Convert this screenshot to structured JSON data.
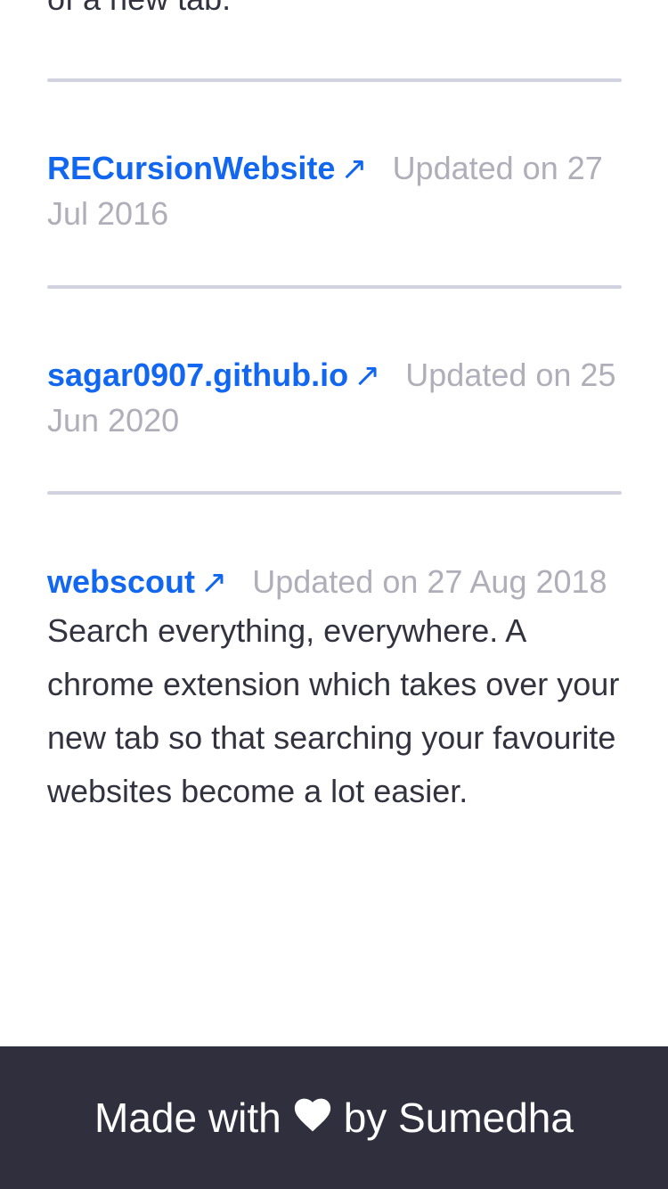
{
  "partial_text": "of a new tab.",
  "repos": [
    {
      "name": "RECursionWebsite",
      "arrow": "↗",
      "updated": "Updated on 27 Jul 2016",
      "description": ""
    },
    {
      "name": "sagar0907.github.io",
      "arrow": "↗",
      "updated": "Updated on 25 Jun 2020",
      "description": ""
    },
    {
      "name": "webscout",
      "arrow": "↗",
      "updated": "Updated on 27 Aug 2018",
      "description": "Search everything, everywhere. A chrome extension which takes over your new tab so that searching your favourite websites become a lot easier."
    }
  ],
  "footer": {
    "made_with": "Made with",
    "heart_icon": "heart-icon",
    "by_author": "by Sumedha"
  },
  "colors": {
    "link": "#1267f0",
    "muted": "#b0aeb9",
    "text": "#333340",
    "divider": "#d2d2e1",
    "footer_bg": "#302f3e"
  }
}
